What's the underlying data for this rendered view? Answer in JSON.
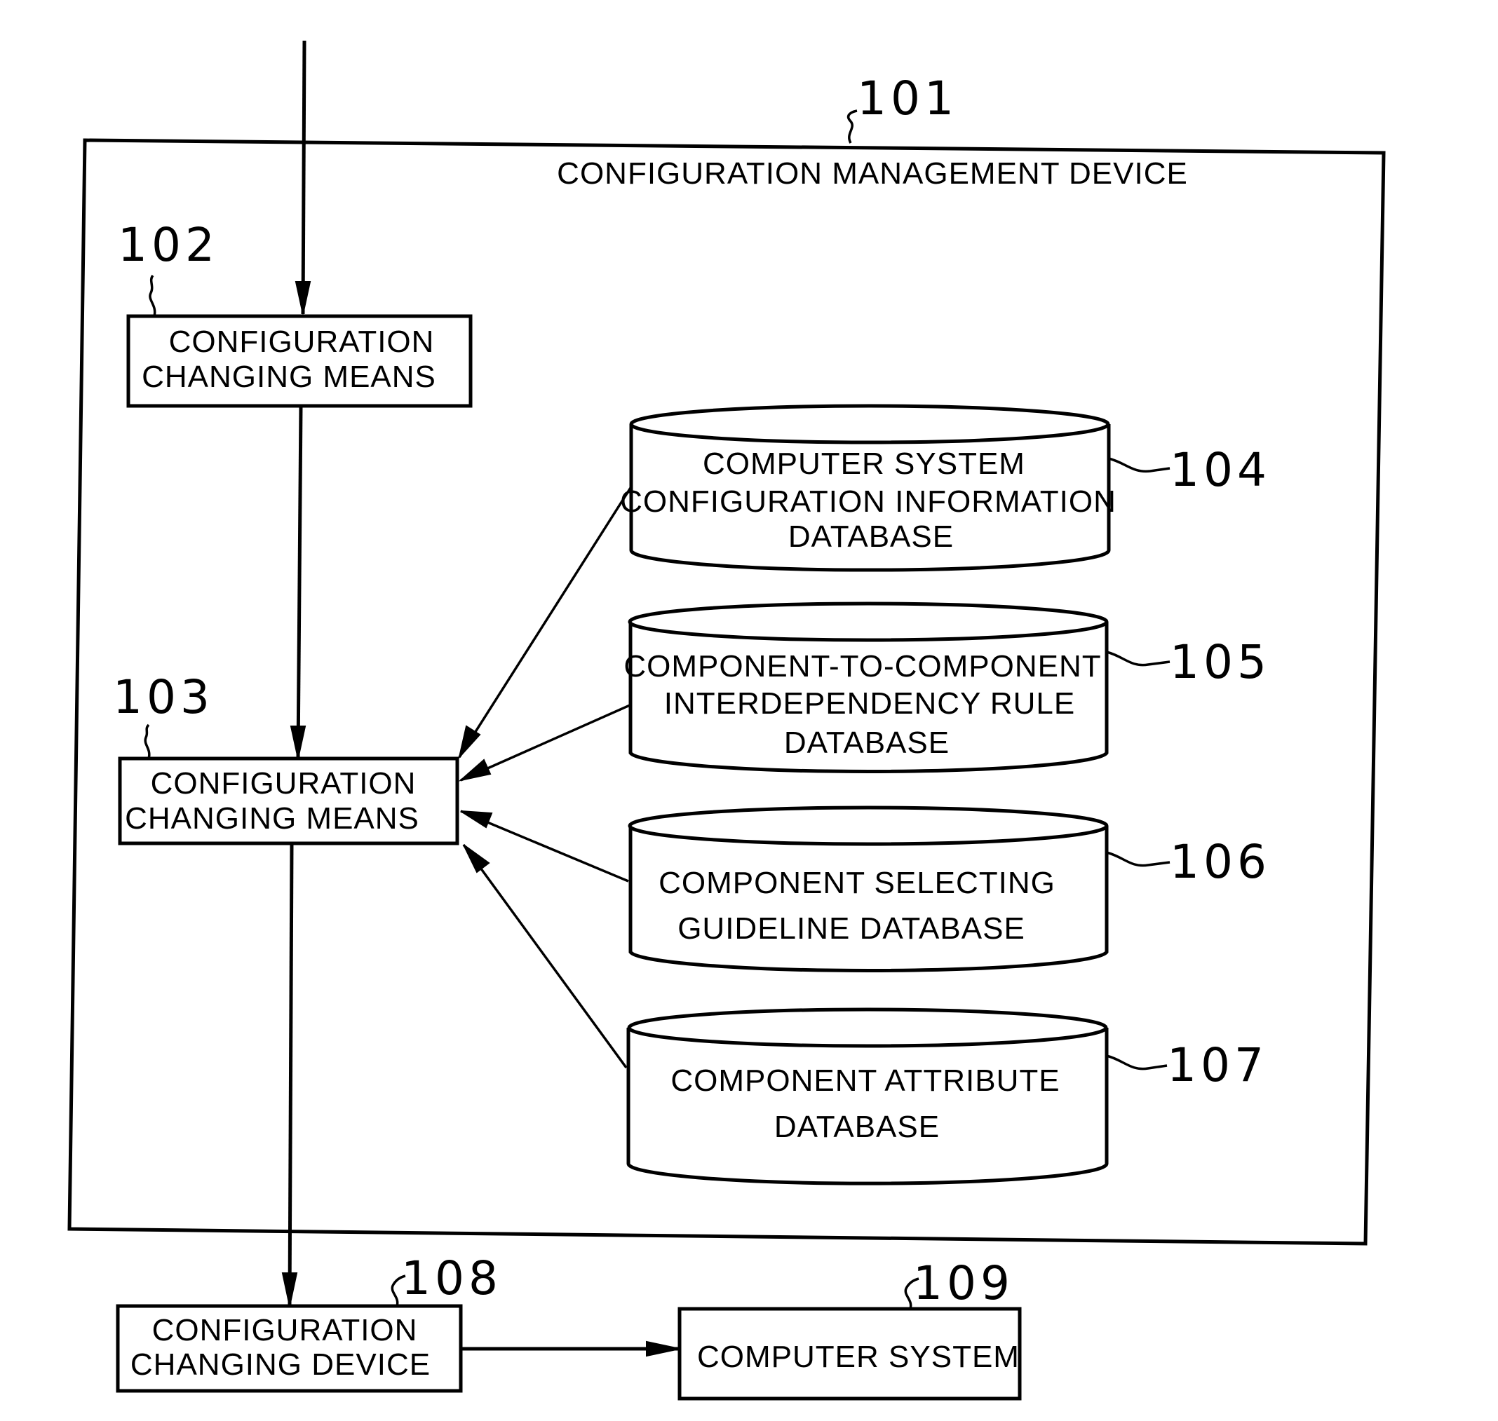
{
  "figure": {
    "container": {
      "ref": "101",
      "title": "CONFIGURATION MANAGEMENT DEVICE"
    },
    "blocks": [
      {
        "ref": "102",
        "lines": [
          "CONFIGURATION",
          "CHANGING MEANS"
        ]
      },
      {
        "ref": "103",
        "lines": [
          "CONFIGURATION",
          "CHANGING MEANS"
        ]
      },
      {
        "ref": "108",
        "lines": [
          "CONFIGURATION",
          "CHANGING DEVICE"
        ]
      },
      {
        "ref": "109",
        "lines": [
          "COMPUTER SYSTEM"
        ]
      }
    ],
    "databases": [
      {
        "ref": "104",
        "lines": [
          "COMPUTER SYSTEM",
          "CONFIGURATION INFORMATION",
          "DATABASE"
        ]
      },
      {
        "ref": "105",
        "lines": [
          "COMPONENT-TO-COMPONENT",
          "INTERDEPENDENCY RULE",
          "DATABASE"
        ]
      },
      {
        "ref": "106",
        "lines": [
          "COMPONENT SELECTING",
          "GUIDELINE DATABASE"
        ]
      },
      {
        "ref": "107",
        "lines": [
          "COMPONENT ATTRIBUTE",
          "DATABASE"
        ]
      }
    ],
    "connections": [
      {
        "from": "external-input",
        "to": "102"
      },
      {
        "from": "102",
        "to": "103"
      },
      {
        "from": "104",
        "to": "103"
      },
      {
        "from": "105",
        "to": "103"
      },
      {
        "from": "106",
        "to": "103"
      },
      {
        "from": "107",
        "to": "103"
      },
      {
        "from": "103",
        "to": "108"
      },
      {
        "from": "108",
        "to": "109"
      }
    ]
  }
}
